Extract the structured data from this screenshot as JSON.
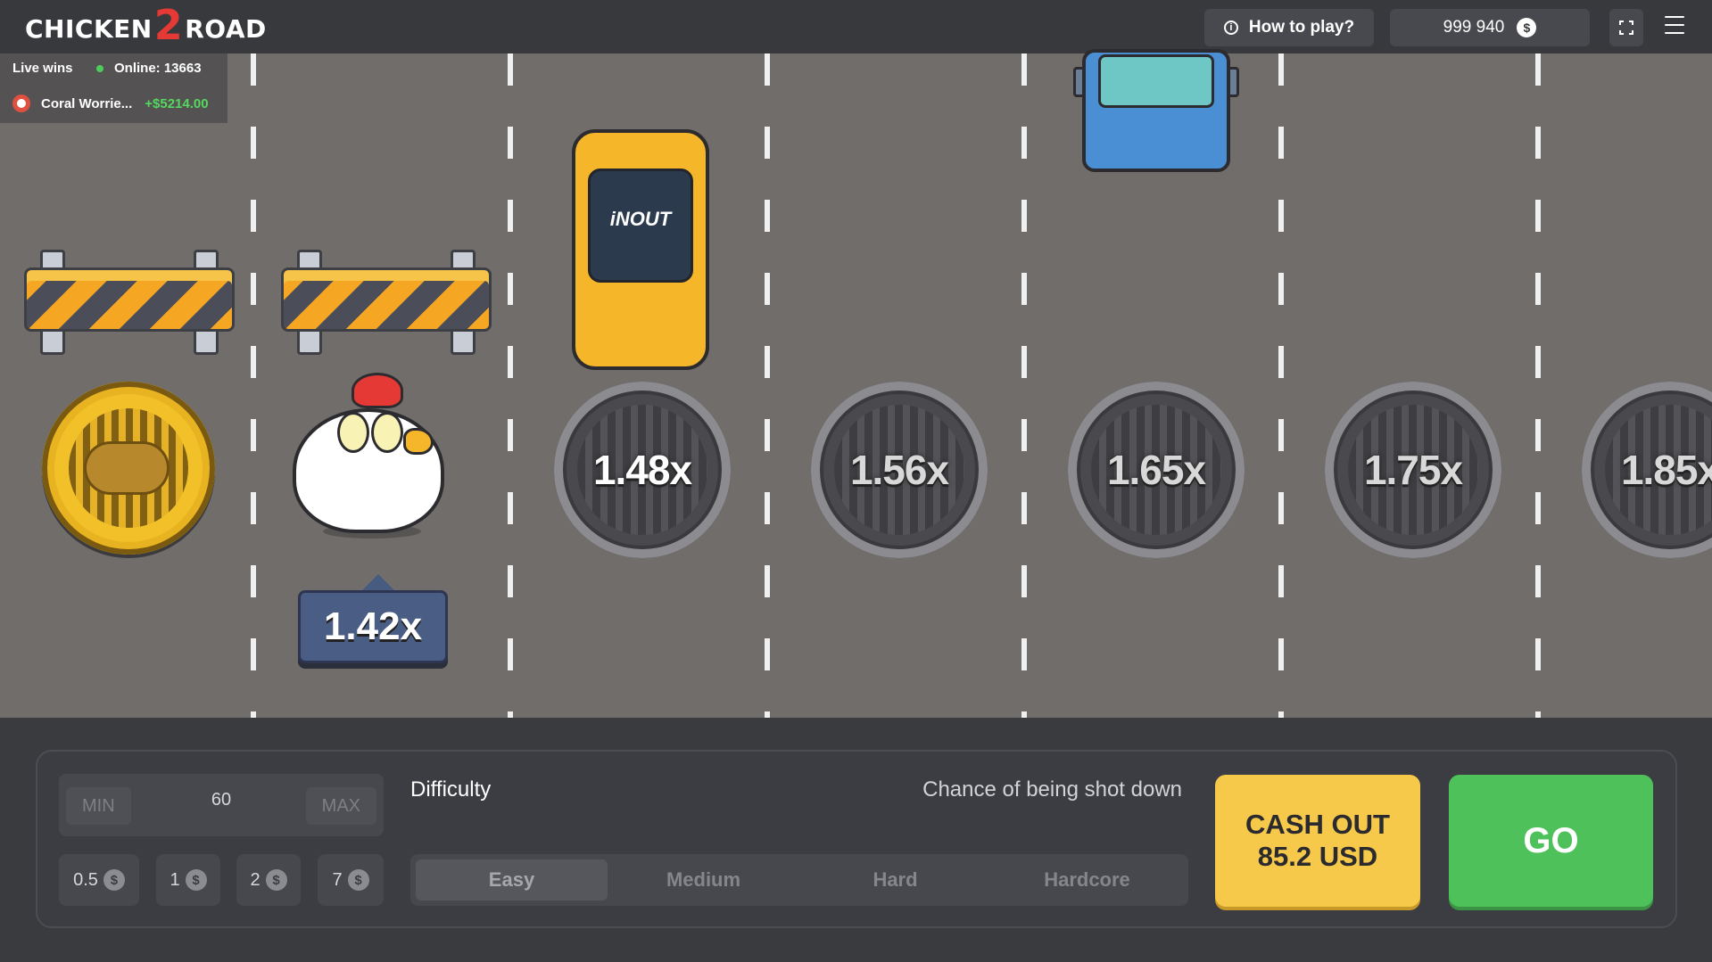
{
  "header": {
    "logo_left": "CHICKEN",
    "logo_number": "2",
    "logo_right": "ROAD",
    "how_to_play": "How to play?",
    "info_icon": "i",
    "balance": "999 940",
    "currency_icon": "$"
  },
  "live": {
    "title": "Live wins",
    "online": "Online: 13663",
    "recent_win": {
      "name": "Coral Worrie...",
      "amount": "+$5214.00"
    }
  },
  "game": {
    "current_multiplier": "1.42x",
    "multipliers": [
      "1.48x",
      "1.56x",
      "1.65x",
      "1.75x",
      "1.85x"
    ],
    "vehicle_logo": "iNOUT",
    "colors": {
      "road": "#716d6a",
      "go": "#4fc15b",
      "cashout": "#f6c94a",
      "tag": "#4a5e85"
    }
  },
  "controls": {
    "min_label": "MIN",
    "max_label": "MAX",
    "bet_value": "60",
    "quick_bets": [
      "0.5",
      "1",
      "2",
      "7"
    ],
    "chip_icon": "$",
    "difficulty_label": "Difficulty",
    "chance_label": "Chance of being shot down",
    "difficulties": [
      "Easy",
      "Medium",
      "Hard",
      "Hardcore"
    ],
    "active_difficulty": "Easy",
    "cashout_line1": "CASH OUT",
    "cashout_line2": "85.2 USD",
    "go_label": "GO"
  }
}
